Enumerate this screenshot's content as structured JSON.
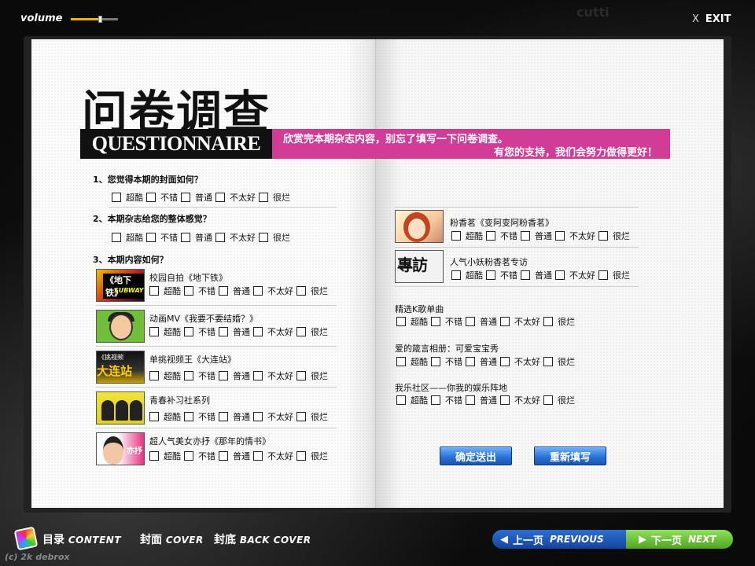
{
  "topbar": {
    "volume_label": "volume",
    "volume_level": 0.62,
    "cutting_text": "cutti",
    "exit_x": "X",
    "exit_label": "EXIT"
  },
  "header": {
    "title_cn": "问卷调查",
    "title_en": "QUESTIONNAIRE",
    "banner_line1": "欣赏完本期杂志内容，别忘了填写一下问卷调查。",
    "banner_line2": "有您的支持，我们会努力做得更好！"
  },
  "options": [
    "超酷",
    "不错",
    "普通",
    "不太好",
    "很烂"
  ],
  "questions": {
    "q1": "1、您觉得本期的封面如何？",
    "q2": "2、本期杂志给您的整体感觉？",
    "q3": "3、本期内容如何？"
  },
  "left_items": [
    {
      "title": "校园自拍《地下铁》",
      "thumb_tag": "《地下铁》",
      "thumb_sub": "SUBWAY"
    },
    {
      "title": "动画MV《我要不要结婚？》"
    },
    {
      "title": "单挑视频王《大连站》",
      "thumb_tag": "《挑视频",
      "thumb_big": "大连站"
    },
    {
      "title": "青春补习社系列"
    },
    {
      "title": "超人气美女亦抒《那年的情书》",
      "thumb_tag": "亦抒"
    }
  ],
  "right_items": [
    {
      "title": "粉香茗《变阿变阿粉香茗》"
    },
    {
      "title": "人气小妖粉香茗专访",
      "thumb_tag": "專訪"
    }
  ],
  "sections": [
    {
      "title": "精选K歌单曲"
    },
    {
      "title": "爱的箴言相册：可爱宝宝秀"
    },
    {
      "title": "我乐社区——你我的娱乐阵地"
    }
  ],
  "form": {
    "submit_label": "确定送出",
    "reset_label": "重新填写"
  },
  "bottom_nav": {
    "contents_cn": "目录",
    "contents_en": "CONTENT",
    "cover_cn": "封面",
    "cover_en": "COVER",
    "back_cn": "封底",
    "back_en": "BACK COVER",
    "copyright": "(c) 2k debrox",
    "prev_cn": "上一页",
    "prev_en": "PREVIOUS",
    "next_cn": "下一页",
    "next_en": "NEXT"
  }
}
